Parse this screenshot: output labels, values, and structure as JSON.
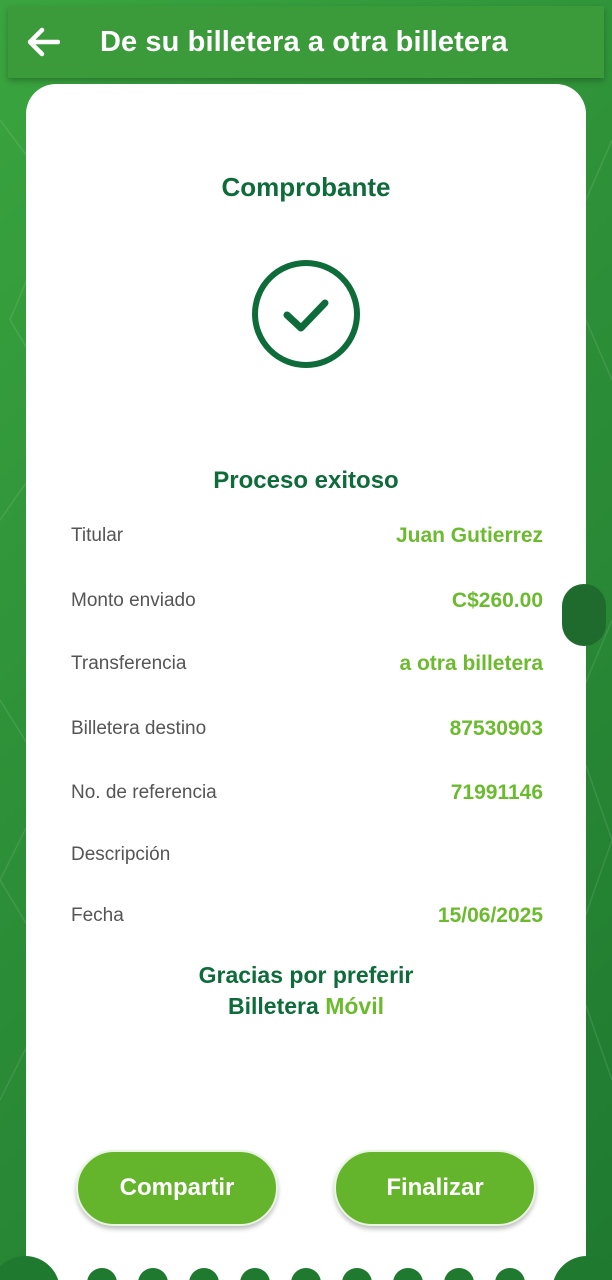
{
  "header": {
    "title": "De su billetera a otra billetera",
    "back_icon": "arrow-left-icon"
  },
  "receipt": {
    "title": "Comprobante",
    "status_icon": "check-circle-icon",
    "status": "Proceso exitoso",
    "rows": [
      {
        "label": "Titular",
        "value": "Juan Gutierrez"
      },
      {
        "label": "Monto enviado",
        "value": "C$260.00"
      },
      {
        "label": "Transferencia",
        "value": "a otra billetera"
      },
      {
        "label": "Billetera destino",
        "value": "87530903"
      },
      {
        "label": "No. de referencia",
        "value": "71991146"
      },
      {
        "label": "Descripción",
        "value": ""
      },
      {
        "label": "Fecha",
        "value": "15/06/2025"
      }
    ],
    "thanks_line1": "Gracias por preferir",
    "thanks_brand": "Billetera",
    "thanks_brand_accent": "Móvil"
  },
  "actions": {
    "share_label": "Compartir",
    "finish_label": "Finalizar"
  },
  "colors": {
    "primary_green": "#0e6b3a",
    "accent_green": "#6cbb2f",
    "header_green": "#3b9a3a"
  }
}
